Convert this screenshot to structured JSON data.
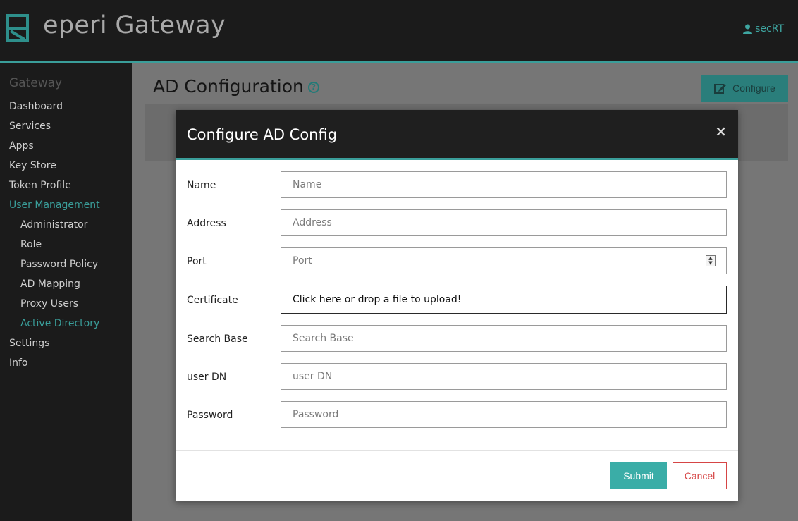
{
  "header": {
    "brand": "eperi Gateway",
    "user": "secRT",
    "accent_color": "#3a9e9a"
  },
  "sidebar": {
    "heading": "Gateway",
    "items": [
      {
        "label": "Dashboard",
        "level": 0,
        "active": false
      },
      {
        "label": "Services",
        "level": 0,
        "active": false
      },
      {
        "label": "Apps",
        "level": 0,
        "active": false
      },
      {
        "label": "Key Store",
        "level": 0,
        "active": false
      },
      {
        "label": "Token Profile",
        "level": 0,
        "active": false
      },
      {
        "label": "User Management",
        "level": 0,
        "active": true
      },
      {
        "label": "Administrator",
        "level": 1,
        "active": false
      },
      {
        "label": "Role",
        "level": 1,
        "active": false
      },
      {
        "label": "Password Policy",
        "level": 1,
        "active": false
      },
      {
        "label": "AD Mapping",
        "level": 1,
        "active": false
      },
      {
        "label": "Proxy Users",
        "level": 1,
        "active": false
      },
      {
        "label": "Active Directory",
        "level": 1,
        "active": true
      },
      {
        "label": "Settings",
        "level": 0,
        "active": false
      },
      {
        "label": "Info",
        "level": 0,
        "active": false
      }
    ]
  },
  "main": {
    "title": "AD Configuration",
    "help_icon": "question-circle-icon",
    "configure_label": "Configure",
    "configure_icon": "edit-icon"
  },
  "modal": {
    "title": "Configure AD Config",
    "close_glyph": "×",
    "fields": {
      "name": {
        "label": "Name",
        "placeholder": "Name",
        "value": ""
      },
      "address": {
        "label": "Address",
        "placeholder": "Address",
        "value": ""
      },
      "port": {
        "label": "Port",
        "placeholder": "Port",
        "value": ""
      },
      "certificate": {
        "label": "Certificate",
        "drop_text": "Click here or drop a file to upload!"
      },
      "search_base": {
        "label": "Search Base",
        "placeholder": "Search Base",
        "value": ""
      },
      "user_dn": {
        "label": "user DN",
        "placeholder": "user DN",
        "value": ""
      },
      "password": {
        "label": "Password",
        "placeholder": "Password",
        "value": ""
      }
    },
    "submit_label": "Submit",
    "cancel_label": "Cancel",
    "submit_color": "#3aada7",
    "cancel_color": "#d64545"
  }
}
